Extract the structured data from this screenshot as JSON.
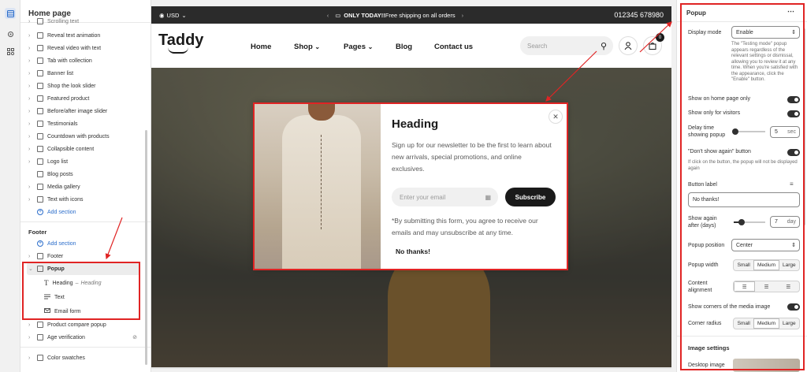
{
  "rail": {
    "items": [
      "sections-icon",
      "settings-icon",
      "apps-icon"
    ]
  },
  "left_panel": {
    "title": "Home page",
    "partial_top": "Scrolling text",
    "items": [
      "Reveal text animation",
      "Reveal video with text",
      "Tab with collection",
      "Banner list",
      "Shop the look slider",
      "Featured product",
      "Before/after image slider",
      "Testimonials",
      "Countdown with products",
      "Collapsible content",
      "Logo list",
      "Blog posts",
      "Media gallery",
      "Text with icons"
    ],
    "add_section": "Add section",
    "footer_label": "Footer",
    "footer_add": "Add section",
    "footer_item": "Footer",
    "popup": "Popup",
    "popup_children": {
      "heading": "Heading",
      "heading_sub": "Heading",
      "text": "Text",
      "email": "Email form"
    },
    "after_items": [
      "Product compare popup",
      "Age verification"
    ],
    "color_swatches": "Color swatches"
  },
  "store": {
    "currency": "USD",
    "announcement_bold": "ONLY TODAY!!",
    "announcement_rest": " Free shipping on all orders",
    "phone": "012345 678980",
    "logo": "Taddy",
    "nav": [
      "Home",
      "Shop",
      "Pages",
      "Blog",
      "Contact us"
    ],
    "search_placeholder": "Search",
    "cart_count": "0"
  },
  "popup_preview": {
    "heading": "Heading",
    "text": "Sign up for our newsletter to be the first to learn about new arrivals, special promotions, and online exclusives.",
    "email_placeholder": "Enter your email",
    "subscribe": "Subscribe",
    "disclaimer": "*By submitting this form, you agree to receive our emails and may unsubscribe at any time.",
    "no_thanks": "No thanks!"
  },
  "settings": {
    "title": "Popup",
    "display_mode_label": "Display mode",
    "display_mode_value": "Enable",
    "display_mode_hint": "The \"Testing mode\" popup appears regardless of the relevant settings or dismissal, allowing you to review it at any time. When you're satisfied with the appearance, click the \"Enable\" button.",
    "home_only": "Show on home page only",
    "visitors_only": "Show only for visitors",
    "delay_label": "Delay time showing popup",
    "delay_value": "5",
    "delay_unit": "sec",
    "dont_show": "\"Don't show again\" button",
    "dont_show_hint": "If click on the button, the popup will not be displayed again",
    "button_label": "Button label",
    "button_value": "No thanks!",
    "show_again_label": "Show again after (days)",
    "show_again_value": "7",
    "show_again_unit": "day",
    "position_label": "Popup position",
    "position_value": "Center",
    "width_label": "Popup width",
    "width_options": [
      "Small",
      "Medium",
      "Large"
    ],
    "width_selected": "Medium",
    "alignment_label": "Content alignment",
    "corners_label": "Show corners of the media image",
    "radius_label": "Corner radius",
    "radius_options": [
      "Small",
      "Medium",
      "Large"
    ],
    "radius_selected": "Medium",
    "image_settings": "Image settings",
    "desktop_image": "Desktop image"
  },
  "colors": {
    "accent_blue": "#2c6ecb",
    "highlight_red": "#e02424",
    "dark": "#303030"
  }
}
